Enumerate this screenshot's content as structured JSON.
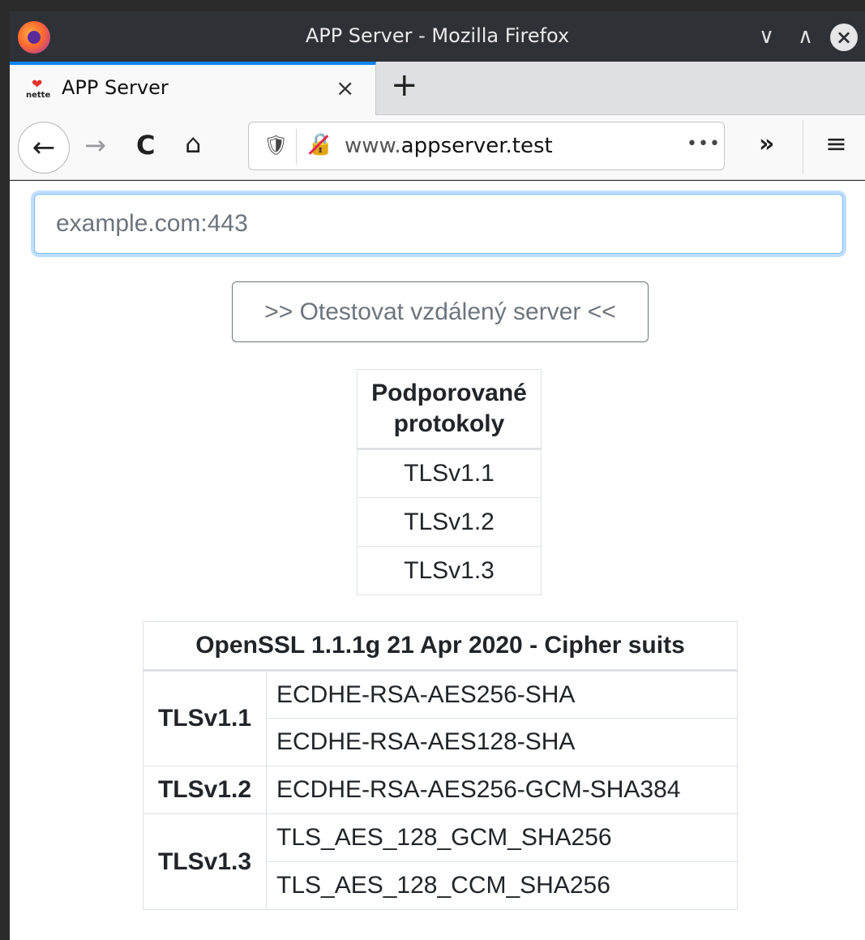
{
  "window": {
    "title": "APP Server - Mozilla Firefox",
    "minimize_glyph": "∨",
    "maximize_glyph": "∧",
    "close_glyph": "×"
  },
  "tab": {
    "label": "APP Server",
    "favicon_text": "nette",
    "close_glyph": "×",
    "new_tab_glyph": "+"
  },
  "navbar": {
    "back_glyph": "←",
    "forward_glyph": "→",
    "reload_glyph": "C",
    "home_glyph": "⌂",
    "url_prefix": "www.",
    "url_domain": "appserver.test",
    "page_actions_glyph": "•••",
    "overflow_glyph": "»",
    "menu_glyph": "≡"
  },
  "form": {
    "host_placeholder": "example.com:443",
    "host_value": "",
    "test_button_label": ">> Otestovat vzdálený server <<"
  },
  "protocols_table": {
    "header_line1": "Podporované",
    "header_line2": "protokoly",
    "rows": [
      "TLSv1.1",
      "TLSv1.2",
      "TLSv1.3"
    ]
  },
  "cipher_table": {
    "header": "OpenSSL 1.1.1g 21 Apr 2020 - Cipher suits",
    "groups": [
      {
        "version": "TLSv1.1",
        "suites": [
          "ECDHE-RSA-AES256-SHA",
          "ECDHE-RSA-AES128-SHA"
        ]
      },
      {
        "version": "TLSv1.2",
        "suites": [
          "ECDHE-RSA-AES256-GCM-SHA384"
        ]
      },
      {
        "version": "TLSv1.3",
        "suites": [
          "TLS_AES_128_GCM_SHA256",
          "TLS_AES_128_CCM_SHA256"
        ]
      }
    ]
  },
  "colors": {
    "active_tab_accent": "#0a84ff",
    "input_focus_border": "#80bdff",
    "secondary_button": "#6c757d",
    "insecure_strike": "#e22850"
  }
}
